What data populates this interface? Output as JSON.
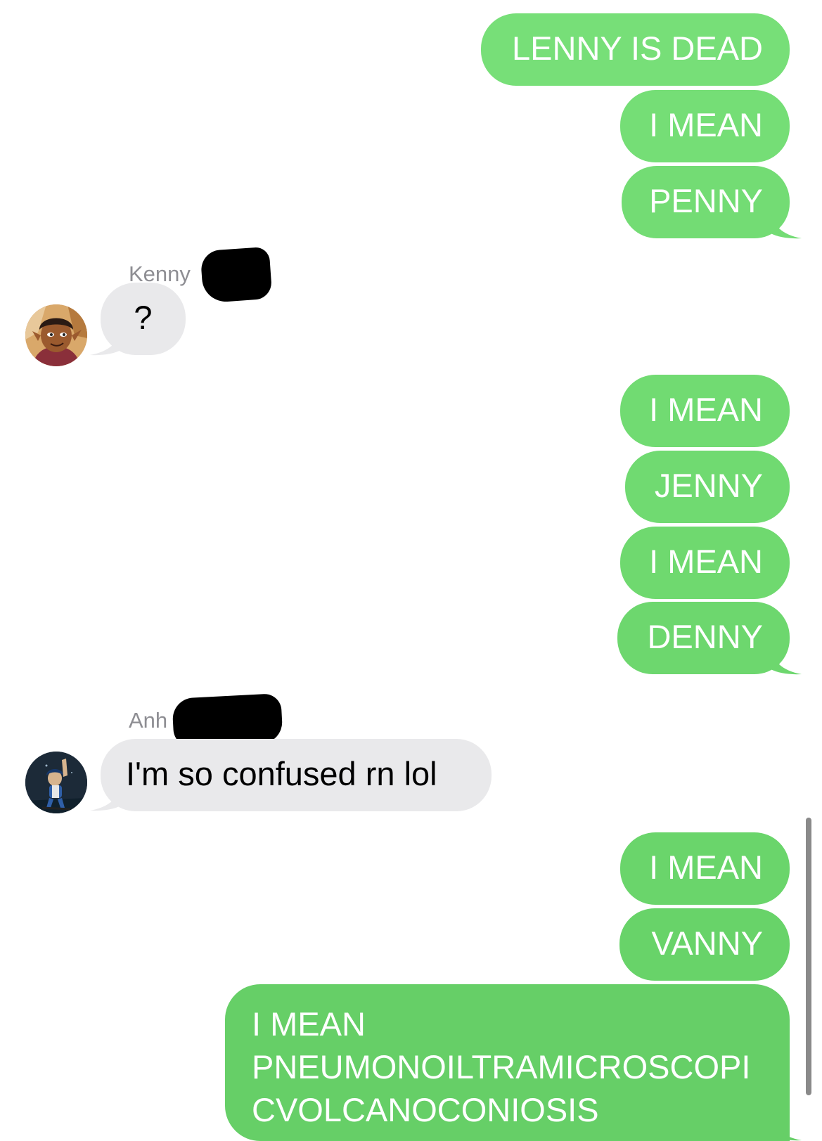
{
  "conversation": {
    "messages": [
      {
        "from": "me",
        "text": "LENNY IS DEAD"
      },
      {
        "from": "me",
        "text": "I MEAN"
      },
      {
        "from": "me",
        "text": "PENNY"
      },
      {
        "from": "Kenny",
        "sender_label": "Kenny",
        "text": "?"
      },
      {
        "from": "me",
        "text": "I MEAN"
      },
      {
        "from": "me",
        "text": "JENNY"
      },
      {
        "from": "me",
        "text": "I MEAN"
      },
      {
        "from": "me",
        "text": "DENNY"
      },
      {
        "from": "Anh",
        "sender_label": "Anh",
        "text": "I'm so confused rn lol"
      },
      {
        "from": "me",
        "text": "I MEAN"
      },
      {
        "from": "me",
        "text": "VANNY"
      },
      {
        "from": "me",
        "lines": [
          "I MEAN",
          "PNEUMONOILTRAMICROSCOPI",
          "CVOLCANOCONIOSIS"
        ]
      }
    ]
  },
  "colors": {
    "outgoing_bubble": "#6fd96f",
    "incoming_bubble": "#e9e9eb",
    "sender_label": "#8e8e93"
  },
  "icons": {
    "kenny_avatar": "cartoon-boy-avatar-icon",
    "anh_avatar": "cartoon-girl-avatar-icon"
  }
}
